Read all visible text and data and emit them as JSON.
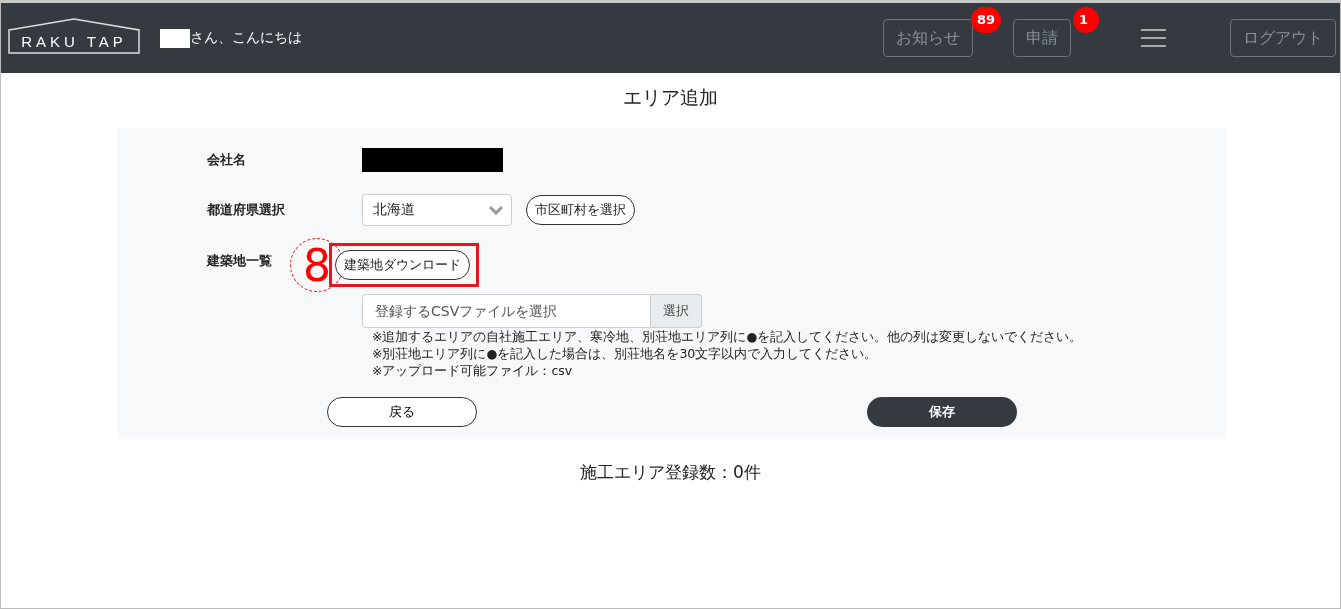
{
  "header": {
    "logo": "RAKU TAP",
    "greeting": "さん、こんにちは",
    "nav": [
      {
        "kind": "button",
        "label": "お知らせ",
        "badge": "89"
      },
      {
        "kind": "button",
        "label": "申請",
        "badge": "1"
      },
      {
        "kind": "menu"
      },
      {
        "kind": "button",
        "label": "ログアウト"
      }
    ]
  },
  "page_title": "エリア追加",
  "form": {
    "company": {
      "label": "会社名"
    },
    "prefecture": {
      "label": "都道府県選択",
      "value": "北海道",
      "button": "市区町村を選択"
    },
    "sites": {
      "label": "建築地一覧",
      "annotation": "8",
      "download_button": "建築地ダウンロード",
      "file_placeholder": "登録するCSVファイルを選択",
      "file_button": "選択",
      "notes": [
        "※追加するエリアの自社施工エリア、寒冷地、別荘地エリア列に●を記入してください。他の列は変更しないでください。",
        "※別荘地エリア列に●を記入した場合は、別荘地名を30文字以内で入力してください。",
        "※アップロード可能ファイル：csv"
      ]
    },
    "back_button": "戻る",
    "save_button": "保存"
  },
  "count_text": "施工エリア登録数：0件"
}
